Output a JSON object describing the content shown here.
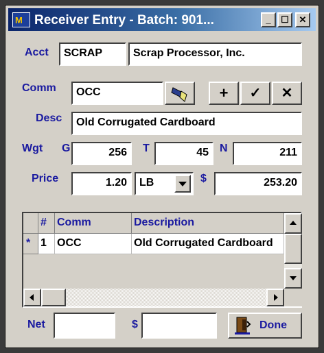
{
  "window": {
    "title": "Receiver Entry - Batch: 901...",
    "minimize": "_",
    "maximize": "☐",
    "close": "✕"
  },
  "account": {
    "label": "Acct",
    "code": "SCRAP",
    "name": "Scrap Processor, Inc."
  },
  "commodity": {
    "label": "Comm",
    "value": "OCC"
  },
  "description": {
    "label": "Desc",
    "value": "Old Corrugated Cardboard"
  },
  "weight": {
    "label": "Wgt",
    "gross_label": "G",
    "gross": "256",
    "tare_label": "T",
    "tare": "45",
    "net_label": "N",
    "net": "211"
  },
  "price": {
    "label": "Price",
    "value": "1.20",
    "unit": "LB",
    "total_label": "$",
    "total": "253.20"
  },
  "actions": {
    "add": "+",
    "accept": "✓",
    "cancel": "✕"
  },
  "grid": {
    "headers": {
      "num": "#",
      "comm": "Comm",
      "description": "Description"
    },
    "rows": [
      {
        "marker": "*",
        "num": "1",
        "comm": "OCC",
        "description": "Old Corrugated Cardboard"
      }
    ]
  },
  "footer": {
    "net_label": "Net",
    "net_value": "",
    "dollar_label": "$",
    "dollar_value": "",
    "done": "Done"
  }
}
